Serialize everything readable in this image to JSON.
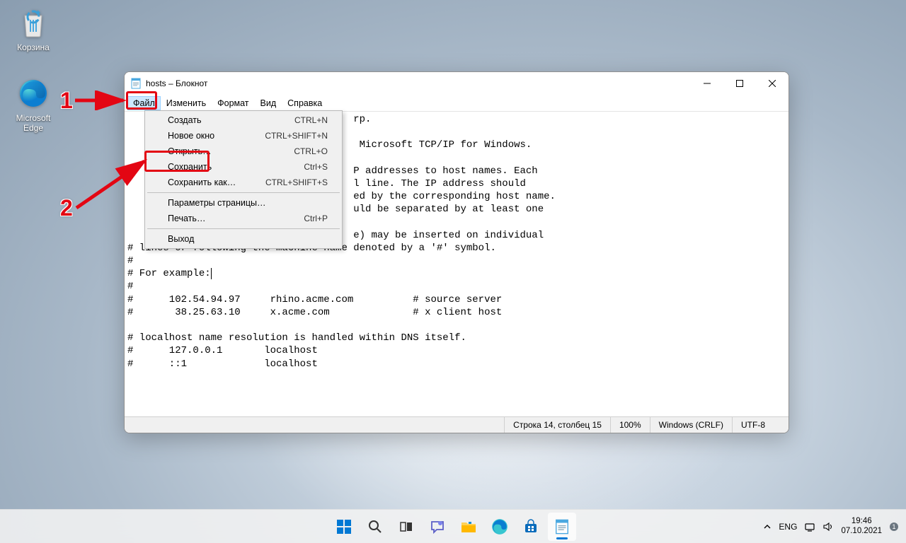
{
  "desktop": {
    "recycle_label": "Корзина",
    "edge_label": "Microsoft Edge"
  },
  "window": {
    "title": "hosts – Блокнот",
    "menubar": {
      "file": "Файл",
      "edit": "Изменить",
      "format": "Формат",
      "view": "Вид",
      "help": "Справка"
    },
    "file_menu": {
      "items": [
        {
          "label": "Создать",
          "shortcut": "CTRL+N"
        },
        {
          "label": "Новое окно",
          "shortcut": "CTRL+SHIFT+N"
        },
        {
          "label": "Открыть…",
          "shortcut": "CTRL+O"
        },
        {
          "label": "Сохранить",
          "shortcut": "Ctrl+S"
        },
        {
          "label": "Сохранить как…",
          "shortcut": "CTRL+SHIFT+S"
        }
      ],
      "items2": [
        {
          "label": "Параметры страницы…",
          "shortcut": ""
        },
        {
          "label": "Печать…",
          "shortcut": "Ctrl+P"
        }
      ],
      "items3": [
        {
          "label": "Выход",
          "shortcut": ""
        }
      ]
    },
    "text_above": "                                      rp.\n\n                                       Microsoft TCP/IP for Windows.\n\n                                      P addresses to host names. Each\n                                      l line. The IP address should\n                                      ed by the corresponding host name.\n                                      uld be separated by at least one\n\n                                      e) may be inserted on individual\n# lines or following the machine name denoted by a '#' symbol.\n#\n# For example:",
    "text_below": "#\n#      102.54.94.97     rhino.acme.com          # source server\n#       38.25.63.10     x.acme.com              # x client host\n\n# localhost name resolution is handled within DNS itself.\n#      127.0.0.1       localhost\n#      ::1             localhost",
    "status": {
      "cursor": "Строка 14, столбец 15",
      "zoom": "100%",
      "eol": "Windows (CRLF)",
      "encoding": "UTF-8"
    }
  },
  "annotations": {
    "num1": "1",
    "num2": "2"
  },
  "systray": {
    "lang": "ENG",
    "time": "19:46",
    "date": "07.10.2021"
  }
}
